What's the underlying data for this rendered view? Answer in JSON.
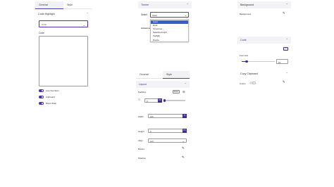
{
  "panel1": {
    "tabs": [
      {
        "label": "General",
        "active": true
      },
      {
        "label": "Style",
        "active": false
      }
    ],
    "section_title": "Code Highlight",
    "language_value": "HTML",
    "code_label": "Code",
    "toggles": [
      {
        "label": "Line Numbers",
        "on": true
      },
      {
        "label": "Clipboard",
        "on": true
      },
      {
        "label": "Word Wrap",
        "on": true
      }
    ]
  },
  "panel2": {
    "section_title": "Theme",
    "select_label": "Select",
    "select_value": "Solid",
    "behind_label": "Advanced",
    "options": [
      {
        "label": "Solid",
        "selected": true
      },
      {
        "label": "Dark",
        "selected": false
      },
      {
        "label": "Tomorrow",
        "selected": false
      },
      {
        "label": "Solarized Light",
        "selected": false
      },
      {
        "label": "Twilight",
        "selected": false
      },
      {
        "label": "Purple",
        "selected": false
      }
    ]
  },
  "panel3": {
    "tabs": [
      {
        "label": "General",
        "active": false
      },
      {
        "label": "Style",
        "active": true
      }
    ],
    "section_title": "Layout",
    "padding_label": "Padding",
    "reset_label": "Reset",
    "padding_value": "0",
    "padding_unit": "PX",
    "width_label": "Width",
    "width_value": "100",
    "width_unit": "%",
    "height_label": "Height",
    "height_value": "0",
    "height_unit": "PX",
    "align_label": "Align",
    "align_value": "Left",
    "border_label": "Border",
    "shadow_label": "Shadow"
  },
  "panel4": {
    "section_title": "Background",
    "background_label": "Background"
  },
  "panel5": {
    "section_title": "Code",
    "font_size_label": "Font size",
    "font_size_value": "16",
    "copy_section_title": "Copy Clipboard",
    "colors_label": "Colors"
  },
  "colors": {
    "accent": "#4b2fb0",
    "accent_dark": "#3b2d94",
    "select_highlight": "#3560c7"
  }
}
